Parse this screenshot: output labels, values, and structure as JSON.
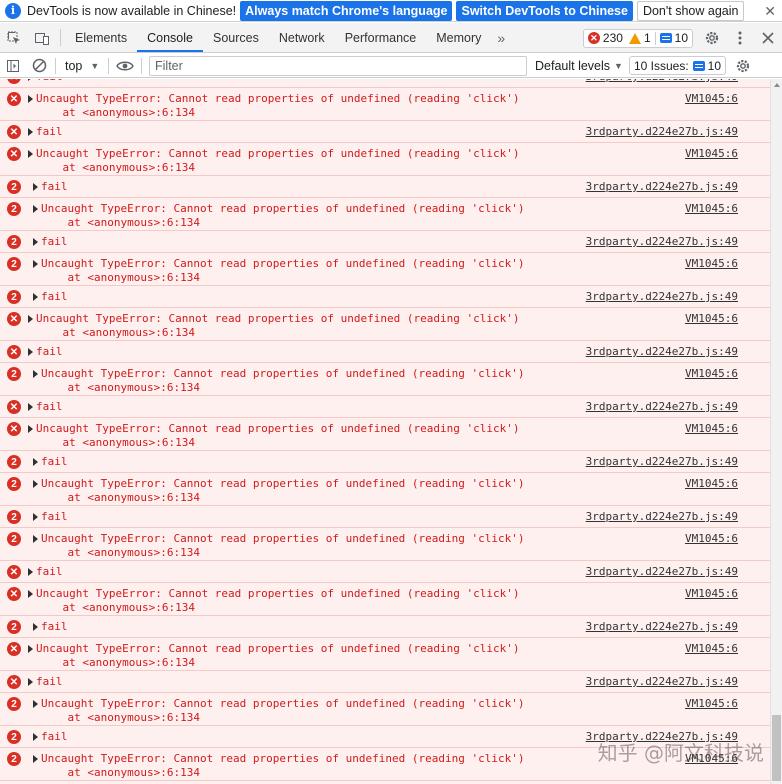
{
  "infobar": {
    "message": "DevTools is now available in Chinese!",
    "match_button": "Always match Chrome's language",
    "switch_button": "Switch DevTools to Chinese",
    "dismiss_button": "Don't show again",
    "close_glyph": "✕"
  },
  "tabs": [
    {
      "label": "Elements",
      "active": false
    },
    {
      "label": "Console",
      "active": true
    },
    {
      "label": "Sources",
      "active": false
    },
    {
      "label": "Network",
      "active": false
    },
    {
      "label": "Performance",
      "active": false
    },
    {
      "label": "Memory",
      "active": false
    }
  ],
  "tabs_more_glyph": "»",
  "counters": {
    "errors": "230",
    "warnings": "1",
    "messages": "10"
  },
  "toolbar": {
    "context": "top",
    "filter_placeholder": "Filter",
    "levels_label": "Default levels",
    "issues_label": "10 Issues:",
    "issues_count": "10"
  },
  "log_rows": [
    {
      "icon": "x",
      "expandable": true,
      "lines": [
        "fail"
      ],
      "source": "3rdparty.d224e27b.js:49"
    },
    {
      "icon": "x",
      "expandable": true,
      "lines": [
        "Uncaught TypeError: Cannot read properties of undefined (reading 'click')",
        "    at <anonymous>:6:134"
      ],
      "source": "VM1045:6"
    },
    {
      "icon": "x",
      "expandable": true,
      "lines": [
        "fail"
      ],
      "source": "3rdparty.d224e27b.js:49"
    },
    {
      "icon": "x",
      "expandable": true,
      "lines": [
        "Uncaught TypeError: Cannot read properties of undefined (reading 'click')",
        "    at <anonymous>:6:134"
      ],
      "source": "VM1045:6"
    },
    {
      "icon": "2",
      "expandable": true,
      "lines": [
        "fail"
      ],
      "source": "3rdparty.d224e27b.js:49"
    },
    {
      "icon": "2",
      "expandable": true,
      "lines": [
        "Uncaught TypeError: Cannot read properties of undefined (reading 'click')",
        "    at <anonymous>:6:134"
      ],
      "source": "VM1045:6"
    },
    {
      "icon": "2",
      "expandable": true,
      "lines": [
        "fail"
      ],
      "source": "3rdparty.d224e27b.js:49"
    },
    {
      "icon": "2",
      "expandable": true,
      "lines": [
        "Uncaught TypeError: Cannot read properties of undefined (reading 'click')",
        "    at <anonymous>:6:134"
      ],
      "source": "VM1045:6"
    },
    {
      "icon": "2",
      "expandable": true,
      "lines": [
        "fail"
      ],
      "source": "3rdparty.d224e27b.js:49"
    },
    {
      "icon": "x",
      "expandable": true,
      "lines": [
        "Uncaught TypeError: Cannot read properties of undefined (reading 'click')",
        "    at <anonymous>:6:134"
      ],
      "source": "VM1045:6"
    },
    {
      "icon": "x",
      "expandable": true,
      "lines": [
        "fail"
      ],
      "source": "3rdparty.d224e27b.js:49"
    },
    {
      "icon": "2",
      "expandable": true,
      "lines": [
        "Uncaught TypeError: Cannot read properties of undefined (reading 'click')",
        "    at <anonymous>:6:134"
      ],
      "source": "VM1045:6"
    },
    {
      "icon": "x",
      "expandable": true,
      "lines": [
        "fail"
      ],
      "source": "3rdparty.d224e27b.js:49"
    },
    {
      "icon": "x",
      "expandable": true,
      "lines": [
        "Uncaught TypeError: Cannot read properties of undefined (reading 'click')",
        "    at <anonymous>:6:134"
      ],
      "source": "VM1045:6"
    },
    {
      "icon": "2",
      "expandable": true,
      "lines": [
        "fail"
      ],
      "source": "3rdparty.d224e27b.js:49"
    },
    {
      "icon": "2",
      "expandable": true,
      "lines": [
        "Uncaught TypeError: Cannot read properties of undefined (reading 'click')",
        "    at <anonymous>:6:134"
      ],
      "source": "VM1045:6"
    },
    {
      "icon": "2",
      "expandable": true,
      "lines": [
        "fail"
      ],
      "source": "3rdparty.d224e27b.js:49"
    },
    {
      "icon": "2",
      "expandable": true,
      "lines": [
        "Uncaught TypeError: Cannot read properties of undefined (reading 'click')",
        "    at <anonymous>:6:134"
      ],
      "source": "VM1045:6"
    },
    {
      "icon": "x",
      "expandable": true,
      "lines": [
        "fail"
      ],
      "source": "3rdparty.d224e27b.js:49"
    },
    {
      "icon": "x",
      "expandable": true,
      "lines": [
        "Uncaught TypeError: Cannot read properties of undefined (reading 'click')",
        "    at <anonymous>:6:134"
      ],
      "source": "VM1045:6"
    },
    {
      "icon": "2",
      "expandable": true,
      "lines": [
        "fail"
      ],
      "source": "3rdparty.d224e27b.js:49"
    },
    {
      "icon": "x",
      "expandable": true,
      "lines": [
        "Uncaught TypeError: Cannot read properties of undefined (reading 'click')",
        "    at <anonymous>:6:134"
      ],
      "source": "VM1045:6"
    },
    {
      "icon": "x",
      "expandable": true,
      "lines": [
        "fail"
      ],
      "source": "3rdparty.d224e27b.js:49"
    },
    {
      "icon": "2",
      "expandable": true,
      "lines": [
        "Uncaught TypeError: Cannot read properties of undefined (reading 'click')",
        "    at <anonymous>:6:134"
      ],
      "source": "VM1045:6"
    },
    {
      "icon": "2",
      "expandable": true,
      "lines": [
        "fail"
      ],
      "source": "3rdparty.d224e27b.js:49"
    },
    {
      "icon": "2",
      "expandable": true,
      "lines": [
        "Uncaught TypeError: Cannot read properties of undefined (reading 'click')",
        "    at <anonymous>:6:134"
      ],
      "source": "VM1045:6"
    }
  ],
  "watermark": "知乎 @阿文科技说",
  "colors": {
    "error_red": "#d93025",
    "error_bg": "#fff0f0",
    "accent_blue": "#1a73e8"
  }
}
